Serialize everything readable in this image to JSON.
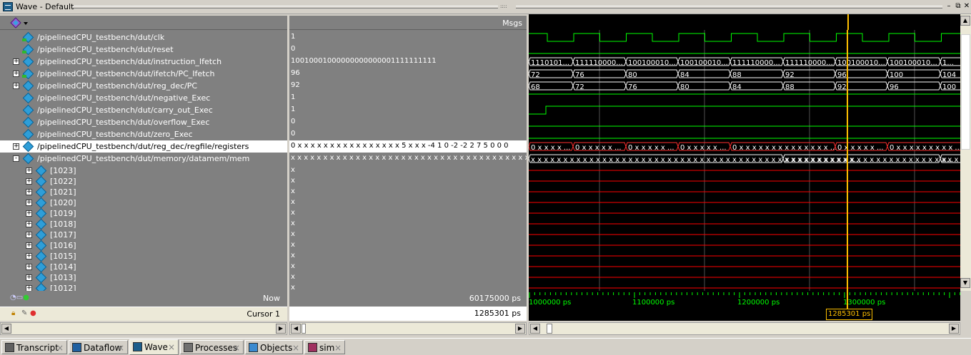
{
  "window": {
    "title": "Wave - Default",
    "colors": {
      "bg": "#d4d0c8",
      "pane": "#808080",
      "wave_green": "#00ff00",
      "cursor": "#ffc000",
      "x_red": "#ff0000"
    }
  },
  "names_header_icon": "wave-toolbar-icon",
  "values_header": "Msgs",
  "signals": [
    {
      "name": "/pipelinedCPU_testbench/dut/clk",
      "value": "1",
      "expand": "",
      "indent": 0,
      "kind": "in"
    },
    {
      "name": "/pipelinedCPU_testbench/dut/reset",
      "value": "0",
      "expand": "",
      "indent": 0,
      "kind": "in"
    },
    {
      "name": "/pipelinedCPU_testbench/dut/instruction_Ifetch",
      "value": "10010001000000000000001111111111",
      "expand": "+",
      "indent": 0,
      "kind": "sig"
    },
    {
      "name": "/pipelinedCPU_testbench/dut/ifetch/PC_Ifetch",
      "value": "96",
      "expand": "+",
      "indent": 0,
      "kind": "in"
    },
    {
      "name": "/pipelinedCPU_testbench/dut/reg_dec/PC",
      "value": "92",
      "expand": "+",
      "indent": 0,
      "kind": "sig"
    },
    {
      "name": "/pipelinedCPU_testbench/dut/negative_Exec",
      "value": "1",
      "expand": "",
      "indent": 0,
      "kind": "sig"
    },
    {
      "name": "/pipelinedCPU_testbench/dut/carry_out_Exec",
      "value": "1",
      "expand": "",
      "indent": 0,
      "kind": "sig"
    },
    {
      "name": "/pipelinedCPU_testbench/dut/overflow_Exec",
      "value": "0",
      "expand": "",
      "indent": 0,
      "kind": "sig"
    },
    {
      "name": "/pipelinedCPU_testbench/dut/zero_Exec",
      "value": "0",
      "expand": "",
      "indent": 0,
      "kind": "sig"
    },
    {
      "name": "/pipelinedCPU_testbench/dut/reg_dec/regfile/registers",
      "value": "0 x x x x x x x x x x x x x x x x 5 x x x -4 1 0 -2 -2 2 7 5 0 0 0",
      "expand": "+",
      "indent": 0,
      "kind": "sig",
      "selected": true
    },
    {
      "name": "/pipelinedCPU_testbench/dut/memory/datamem/mem",
      "value": "x x x x x x x x x x x x x x x x x x x x x x x x x x x x x x x x x x x x x x x x x x x...",
      "expand": "-",
      "indent": 0,
      "kind": "sig"
    },
    {
      "name": "[1023]",
      "value": "x",
      "expand": "+",
      "indent": 1,
      "kind": "sig"
    },
    {
      "name": "[1022]",
      "value": "x",
      "expand": "+",
      "indent": 1,
      "kind": "sig"
    },
    {
      "name": "[1021]",
      "value": "x",
      "expand": "+",
      "indent": 1,
      "kind": "sig"
    },
    {
      "name": "[1020]",
      "value": "x",
      "expand": "+",
      "indent": 1,
      "kind": "sig"
    },
    {
      "name": "[1019]",
      "value": "x",
      "expand": "+",
      "indent": 1,
      "kind": "sig"
    },
    {
      "name": "[1018]",
      "value": "x",
      "expand": "+",
      "indent": 1,
      "kind": "sig"
    },
    {
      "name": "[1017]",
      "value": "x",
      "expand": "+",
      "indent": 1,
      "kind": "sig"
    },
    {
      "name": "[1016]",
      "value": "x",
      "expand": "+",
      "indent": 1,
      "kind": "sig"
    },
    {
      "name": "[1015]",
      "value": "x",
      "expand": "+",
      "indent": 1,
      "kind": "sig"
    },
    {
      "name": "[1014]",
      "value": "x",
      "expand": "+",
      "indent": 1,
      "kind": "sig"
    },
    {
      "name": "[1013]",
      "value": "x",
      "expand": "+",
      "indent": 1,
      "kind": "sig"
    },
    {
      "name": "[1012]",
      "value": "x",
      "expand": "+",
      "indent": 1,
      "kind": "sig"
    }
  ],
  "waves": {
    "instruction": [
      "1110101...",
      "111110000...",
      "100100010...",
      "100100010...",
      "111110000...",
      "111110000...",
      "100100010...",
      "100100010...",
      "1..."
    ],
    "pc_ifetch": [
      "72",
      "76",
      "80",
      "84",
      "88",
      "92",
      "96",
      "100",
      "104"
    ],
    "reg_pc": [
      "68",
      "72",
      "76",
      "80",
      "84",
      "88",
      "92",
      "96",
      "100"
    ],
    "registers": [
      "0 x x x x ...",
      "0 x x x x x ...",
      "0 x x x x x ...",
      "0 x x x x x ...",
      "0 x x x x x x x x x x x x x x ...",
      "0 x x x x x ...",
      "0 x x x x x x x x x ..."
    ],
    "mem": [
      "x x x x x x x x x x x x x x x x x x x x x x x x x x x x x x x x x x x x x x x x x x x x x x x x x x...",
      "x x x x x x x x x x x x x x x x x x x x x x x x x x x x x x x x...",
      "x..."
    ]
  },
  "status": {
    "now_label": "Now",
    "now_value": "60175000 ps",
    "cursor_label": "Cursor 1",
    "cursor_value": "1285301 ps",
    "timeline_labels": [
      "1000000 ps",
      "1100000 ps",
      "1200000 ps",
      "1300000 ps"
    ],
    "cursor_box": "1285301 ps"
  },
  "tabs": [
    {
      "label": "Transcript",
      "icon": "transcript-icon"
    },
    {
      "label": "Dataflow",
      "icon": "dataflow-icon"
    },
    {
      "label": "Wave",
      "icon": "wave-icon",
      "active": true
    },
    {
      "label": "Processes",
      "icon": "processes-icon"
    },
    {
      "label": "Objects",
      "icon": "objects-icon"
    },
    {
      "label": "sim",
      "icon": "sim-icon"
    }
  ]
}
